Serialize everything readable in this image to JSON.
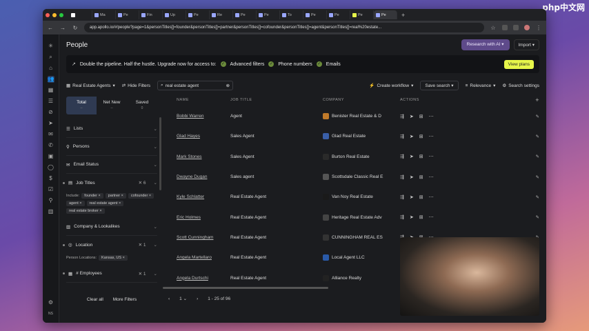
{
  "watermark": "php中文网",
  "browser": {
    "tabs": [
      "Ma",
      "Pe",
      "Fin",
      "Up",
      "Pe",
      "Re",
      "Pe",
      "Pe",
      "To",
      "Pe",
      "Pe",
      "Pe",
      "Pe"
    ],
    "url": "app.apollo.io/#/people?page=1&personTitles[]=founder&personTitles[]=partner&personTitles[]=cofounder&personTitles[]=agent&personTitles[]=real%20estate..."
  },
  "header": {
    "title": "People",
    "research_label": "Research with AI",
    "import_label": "Import"
  },
  "banner": {
    "text": "Double the pipeline. Half the hustle. Upgrade now for access to:",
    "features": [
      "Advanced filters",
      "Phone numbers",
      "Emails"
    ],
    "cta": "View plans"
  },
  "toolbar": {
    "saved_list": "Real Estate Agents",
    "hide_filters": "Hide Filters",
    "search_value": "real estate agent",
    "create_workflow": "Create workflow",
    "save_search": "Save search",
    "relevance": "Relevance",
    "search_settings": "Search settings"
  },
  "filters": {
    "segments": [
      {
        "label": "Total",
        "count": "--"
      },
      {
        "label": "Net New",
        "count": "--"
      },
      {
        "label": "Saved",
        "count": "0"
      }
    ],
    "lists": "Lists",
    "persons": "Persons",
    "email_status": "Email Status",
    "job_titles": "Job Titles",
    "job_titles_count": "6",
    "include_label": "Include:",
    "job_chips": [
      "founder",
      "partner",
      "cofounder",
      "agent",
      "real estate agent",
      "real estate broker"
    ],
    "company": "Company & Lookalikes",
    "location": "Location",
    "location_count": "1",
    "person_locations_label": "Person Locations:",
    "location_chip": "Kansas, US",
    "employees": "# Employees",
    "employees_count": "1",
    "clear_all": "Clear all",
    "more_filters": "More Filters"
  },
  "table": {
    "headers": {
      "name": "NAME",
      "title": "JOB TITLE",
      "company": "COMPANY",
      "actions": "ACTIONS"
    },
    "rows": [
      {
        "name": "Bobbi Warren",
        "title": "Agent",
        "company": "Benister Real Estate & D"
      },
      {
        "name": "Glad Hayes",
        "title": "Sales Agent",
        "company": "Glad Real Estate"
      },
      {
        "name": "Mark Stones",
        "title": "Sales Agent",
        "company": "Burton Real Estate"
      },
      {
        "name": "Dwayne Dugan",
        "title": "Sales agent",
        "company": "Scottsdale Classic Real E"
      },
      {
        "name": "Kyle Schlatter",
        "title": "Real Estate Agent",
        "company": "Van Noy Real Estate"
      },
      {
        "name": "Eric Holmes",
        "title": "Real Estate Agent",
        "company": "Heritage Real Estate Adv"
      },
      {
        "name": "Scott Cunningham",
        "title": "Real Estate Agent",
        "company": "CUNNINGHAM REAL ES"
      },
      {
        "name": "Angela Martellaro",
        "title": "Real Estate Agent",
        "company": "Local Agent LLC"
      },
      {
        "name": "Angela Durtschi",
        "title": "Real Estate Agent",
        "company": "Alliance Realty"
      }
    ]
  },
  "pager": {
    "page": "1",
    "range": "1 - 25 of 96"
  },
  "colors": {
    "accent": "#e6f54a",
    "ai_button": "#5e4a8a",
    "selected": "#2f3a52"
  }
}
